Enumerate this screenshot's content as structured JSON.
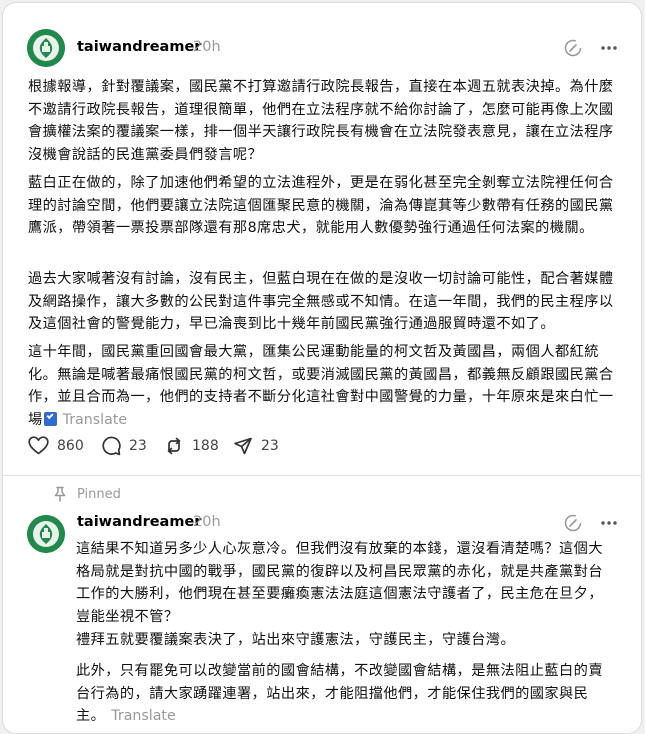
{
  "post1": {
    "username": "taiwandreamer",
    "time": "20h",
    "paragraphs": [
      "根據報導，針對覆議案，國民黨不打算邀請行政院長報告，直接在本週五就表決掉。為什麼不邀請行政院長報告，道理很簡單，他們在立法程序就不給你討論了，怎麼可能再像上次國會擴權法案的覆議案一樣，排一個半天讓行政院長有機會在立法院發表意見，讓在立法程序沒機會說話的民進黨委員們發言呢？",
      "藍白正在做的，除了加速他們希望的立法進程外，更是在弱化甚至完全剝奪立法院裡任何合理的討論空間，他們要讓立法院這個匯聚民意的機關，淪為傳崑萁等少數帶有任務的國民黨鷹派，帶領著一票投票部隊還有那8席忠犬，就能用人數優勢強行通過任何法案的機關。",
      "過去大家喊著沒有討論，沒有民主，但藍白現在在做的是沒收一切討論可能性，配合著媒體及網路操作，讓大多數的公民對這件事完全無感或不知情。在這一年間，我們的民主程序以及這個社會的警覺能力，早已淪喪到比十幾年前國民黨強行通過服貿時還不如了。",
      "這十年間，國民黨重回國會最大黨，匯集公民運動能量的柯文哲及黃國昌，兩個人都紅統化。無論是喊著最痛恨國民黨的柯文哲，或要消滅國民黨的黃國昌，都義無反顧跟國民黨合作，並且合而為一，他們的支持者不斷分化這社會對中國警覺的力量，十年原來是來白忙一場"
    ],
    "translate": "Translate",
    "likes": "860",
    "comments": "23",
    "reposts": "188",
    "shares": "23"
  },
  "pinned_label": "Pinned",
  "post2": {
    "username": "taiwandreamer",
    "time": "20h",
    "paragraphs": [
      "這結果不知道另多少人心灰意冷。但我們沒有放棄的本錢，還沒看清楚嗎？這個大格局就是對抗中國的戰爭，國民黨的復辟以及柯昌民眾黨的赤化，就是共產黨對台工作的大勝利，他們現在甚至要癱瘓憲法法庭這個憲法守護者了，民主危在旦夕，豈能坐視不管？",
      "禮拜五就要覆議案表決了，站出來守護憲法，守護民主，守護台灣。",
      "此外，只有罷免可以改變當前的國會結構，不改變國會結構，是無法阻止藍白的賣台行為的，請大家踴躍連署，站出來，才能阻擋他們，才能保住我們的國家與民主。"
    ],
    "translate": "Translate"
  }
}
